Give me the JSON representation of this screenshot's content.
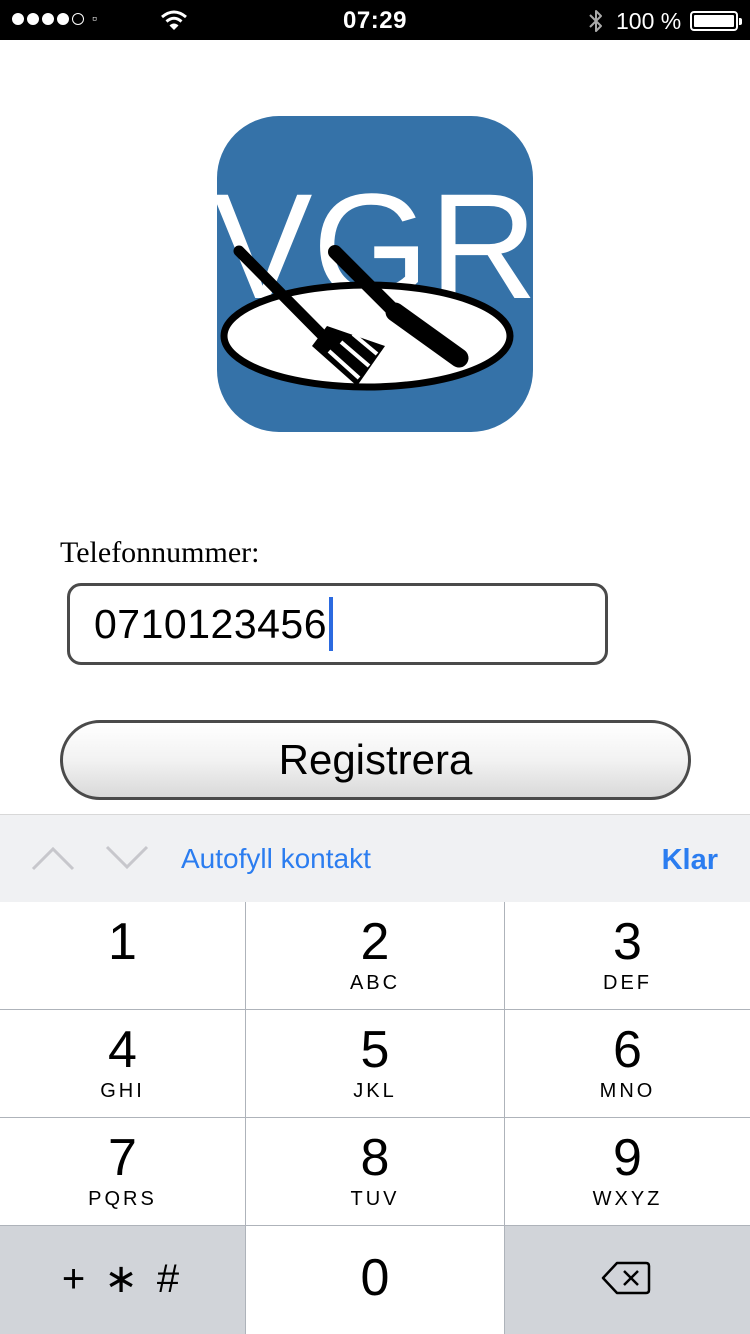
{
  "status_bar": {
    "signal_dots_filled": 4,
    "signal_dots_total": 5,
    "time": "07:29",
    "battery_percent": "100 %",
    "battery_level": 1.0
  },
  "logo": {
    "text": "VGR",
    "background_color": "#3572a8"
  },
  "form": {
    "phone_label": "Telefonnummer:",
    "phone_value": "0710123456",
    "register_label": "Registrera"
  },
  "keyboard_bar": {
    "autofill_label": "Autofyll kontakt",
    "done_label": "Klar",
    "accent_color": "#2b7df0"
  },
  "keypad": {
    "keys": [
      {
        "digit": "1",
        "letters": ""
      },
      {
        "digit": "2",
        "letters": "ABC"
      },
      {
        "digit": "3",
        "letters": "DEF"
      },
      {
        "digit": "4",
        "letters": "GHI"
      },
      {
        "digit": "5",
        "letters": "JKL"
      },
      {
        "digit": "6",
        "letters": "MNO"
      },
      {
        "digit": "7",
        "letters": "PQRS"
      },
      {
        "digit": "8",
        "letters": "TUV"
      },
      {
        "digit": "9",
        "letters": "WXYZ"
      }
    ],
    "symbols_label": "+ ∗ #",
    "zero": "0",
    "delete_icon": "backspace-icon"
  }
}
